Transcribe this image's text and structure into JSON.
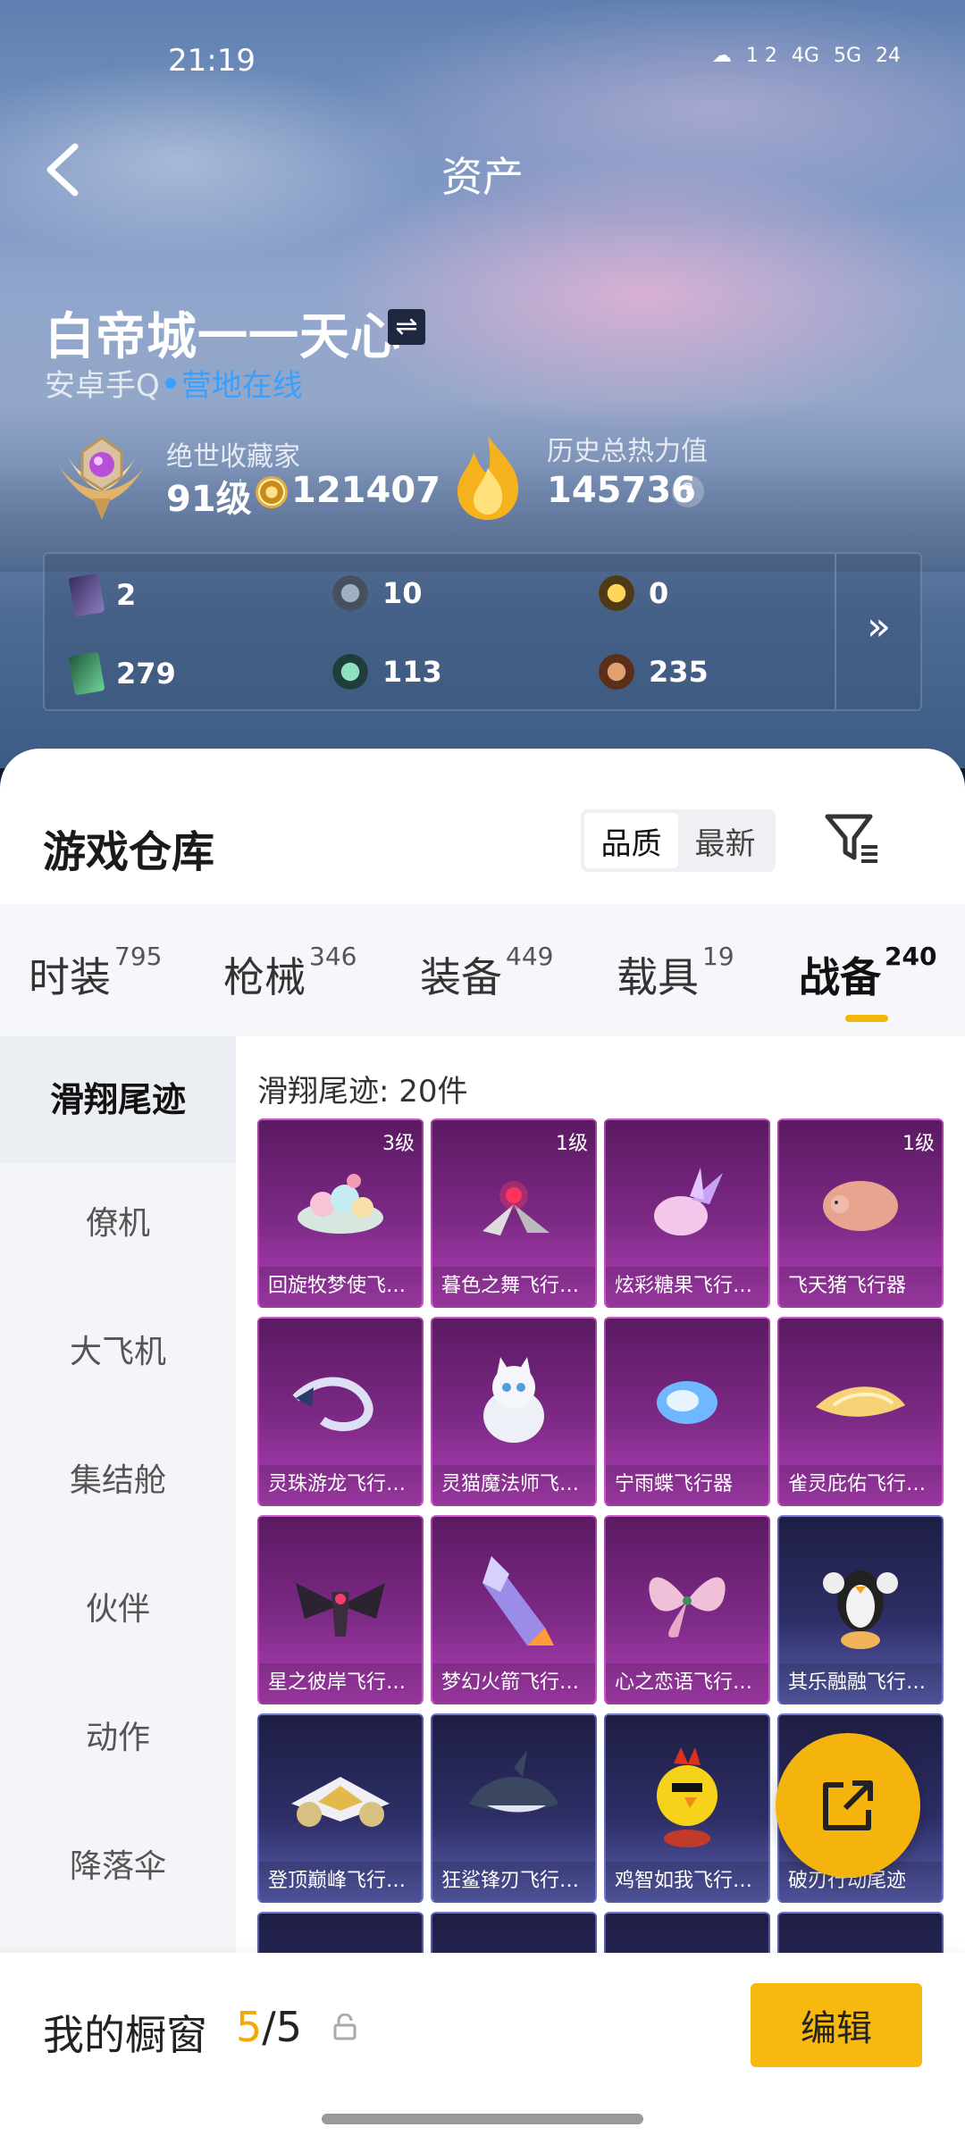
{
  "status_bar": {
    "time": "21:19",
    "icons": [
      "☁",
      "1 2",
      "4G",
      "5G",
      "24",
      "wifi"
    ]
  },
  "header": {
    "title": "资产",
    "back_icon": "chevron-left-icon"
  },
  "profile": {
    "name": "白帝城一一天心",
    "platform": "安卓手Q",
    "online_text": "营地在线",
    "collector_title": "绝世收藏家",
    "level": "91级",
    "coins": "121407",
    "heat_title": "历史总热力值",
    "heat_value": "145736",
    "help": "?"
  },
  "assets": [
    {
      "icon": "purple-card",
      "value": "2"
    },
    {
      "icon": "silver-coin",
      "value": "10"
    },
    {
      "icon": "gold-coin",
      "value": "0"
    },
    {
      "icon": "green-card",
      "value": "279"
    },
    {
      "icon": "teal-orb",
      "value": "113"
    },
    {
      "icon": "bronze-orb",
      "value": "235"
    }
  ],
  "warehouse": {
    "title": "游戏仓库",
    "sort_options": [
      "品质",
      "最新"
    ],
    "active_sort": "品质"
  },
  "tabs": [
    {
      "label": "时装",
      "count": "795"
    },
    {
      "label": "枪械",
      "count": "346"
    },
    {
      "label": "装备",
      "count": "449"
    },
    {
      "label": "载具",
      "count": "19"
    },
    {
      "label": "战备",
      "count": "240"
    }
  ],
  "active_tab": "战备",
  "sidebar": [
    "滑翔尾迹",
    "僚机",
    "大飞机",
    "集结舱",
    "伙伴",
    "动作",
    "降落伞"
  ],
  "active_sidebar": "滑翔尾迹",
  "count_label": "滑翔尾迹: 20件",
  "items": [
    {
      "name": "回旋牧梦使飞…",
      "level": "3级",
      "color": "purple"
    },
    {
      "name": "暮色之舞飞行…",
      "level": "1级",
      "color": "purple"
    },
    {
      "name": "炫彩糖果飞行…",
      "level": "",
      "color": "purple"
    },
    {
      "name": "飞天猪飞行器",
      "level": "1级",
      "color": "purple"
    },
    {
      "name": "灵珠游龙飞行…",
      "level": "",
      "color": "purple"
    },
    {
      "name": "灵猫魔法师飞…",
      "level": "",
      "color": "purple"
    },
    {
      "name": "宁雨蝶飞行器",
      "level": "",
      "color": "purple"
    },
    {
      "name": "雀灵庇佑飞行…",
      "level": "",
      "color": "purple"
    },
    {
      "name": "星之彼岸飞行…",
      "level": "",
      "color": "purple"
    },
    {
      "name": "梦幻火箭飞行…",
      "level": "",
      "color": "purple"
    },
    {
      "name": "心之恋语飞行…",
      "level": "",
      "color": "purple"
    },
    {
      "name": "其乐融融飞行…",
      "level": "",
      "color": "blue"
    },
    {
      "name": "登顶巅峰飞行…",
      "level": "",
      "color": "blue"
    },
    {
      "name": "狂鲨锋刃飞行…",
      "level": "",
      "color": "blue"
    },
    {
      "name": "鸡智如我飞行…",
      "level": "",
      "color": "blue"
    },
    {
      "name": "破刃行动尾迹",
      "level": "",
      "color": "blue"
    }
  ],
  "showcase": {
    "label": "我的橱窗",
    "current": "5",
    "total": "/5"
  },
  "edit_label": "编辑",
  "colors": {
    "accent": "#f5b60a",
    "online": "#3aa0ff"
  }
}
